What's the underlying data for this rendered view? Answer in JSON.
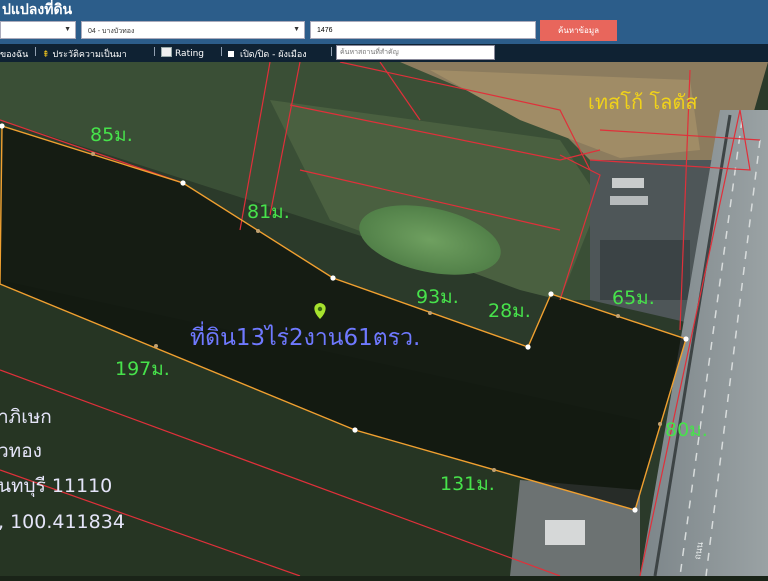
{
  "header": {
    "title": "ปแปลงที่ดิน",
    "district_select": "",
    "subdistrict_select": "04 - บางบัวทอง",
    "parcel_number": "1476",
    "search_button": "ค้นหาข้อมูล"
  },
  "toolbar": {
    "items": [
      {
        "label": "ของฉัน",
        "icon": "user-icon"
      },
      {
        "label": "ประวัติความเป็นมา",
        "icon": "history-icon"
      },
      {
        "label": "Rating",
        "icon": "chart-icon"
      },
      {
        "label": "เปิด/ปิด - ผังเมือง",
        "icon": "checkbox-icon"
      }
    ],
    "place_search_placeholder": "ค้นหาสถานที่สำคัญ"
  },
  "map": {
    "parcel_area_label": "ที่ดิน13ไร่2งาน61ตรว.",
    "edge_labels": [
      "85ม.",
      "81ม.",
      "93ม.",
      "28ม.",
      "65ม.",
      "80ม.",
      "131ม.",
      "197ม."
    ],
    "landmark_label": "เทสโก้ โลตัส",
    "road_label": "ถนน",
    "address_lines": [
      "าภิเษก",
      "วทอง",
      "นทบุรี 11110",
      ", 100.411834"
    ],
    "colors": {
      "parcel_outline": "#f0a030",
      "cadastral_lines": "#e0303a",
      "label_green": "#47e24b",
      "label_area": "#6f79ff",
      "landmark": "#f0d21a",
      "pin": "#a6e22e"
    }
  }
}
